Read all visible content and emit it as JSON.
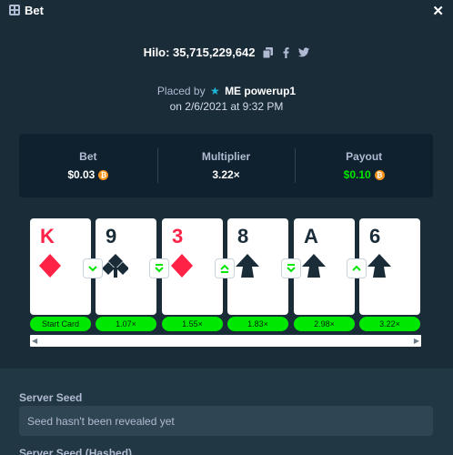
{
  "window": {
    "title": "Bet",
    "title_icon": "game-icon",
    "close_label": "✕"
  },
  "game": {
    "label": "Hilo: 35,715,229,642"
  },
  "share": {
    "copy_icon": "copy-icon",
    "facebook_icon": "facebook-icon",
    "twitter_icon": "twitter-icon"
  },
  "placed": {
    "prefix": "Placed by",
    "user": "ME powerup1",
    "user_icon": "vip-star-icon",
    "date": "on 2/6/2021 at 9:32 PM"
  },
  "stats": {
    "bet_label": "Bet",
    "bet_value": "$0.03",
    "multiplier_label": "Multiplier",
    "multiplier_value": "3.22×",
    "payout_label": "Payout",
    "payout_value": "$0.10",
    "currency_icon": "bitcoin-coin-icon",
    "payout_color": "#00e701"
  },
  "cards": [
    {
      "rank": "K",
      "suit": "diamonds",
      "color": "red",
      "multiplier": "Start Card"
    },
    {
      "rank": "9",
      "suit": "clubs",
      "color": "black",
      "multiplier": "1.07×",
      "guess": "lower"
    },
    {
      "rank": "3",
      "suit": "diamonds",
      "color": "red",
      "multiplier": "1.55×",
      "guess": "lower-or-same"
    },
    {
      "rank": "8",
      "suit": "spades",
      "color": "black",
      "multiplier": "1.83×",
      "guess": "higher-or-same"
    },
    {
      "rank": "A",
      "suit": "spades",
      "color": "black",
      "multiplier": "2.98×",
      "guess": "lower-or-same"
    },
    {
      "rank": "6",
      "suit": "spades",
      "color": "black",
      "multiplier": "3.22×",
      "guess": "higher"
    }
  ],
  "seeds": {
    "server_seed_label": "Server Seed",
    "server_seed_value": "Seed hasn't been revealed yet",
    "server_seed_hashed_label": "Server Seed (Hashed)"
  },
  "colors": {
    "background": "#1a2c38",
    "panel": "#0f212e",
    "accent_green": "#00e701",
    "card_red": "#fe2247"
  }
}
